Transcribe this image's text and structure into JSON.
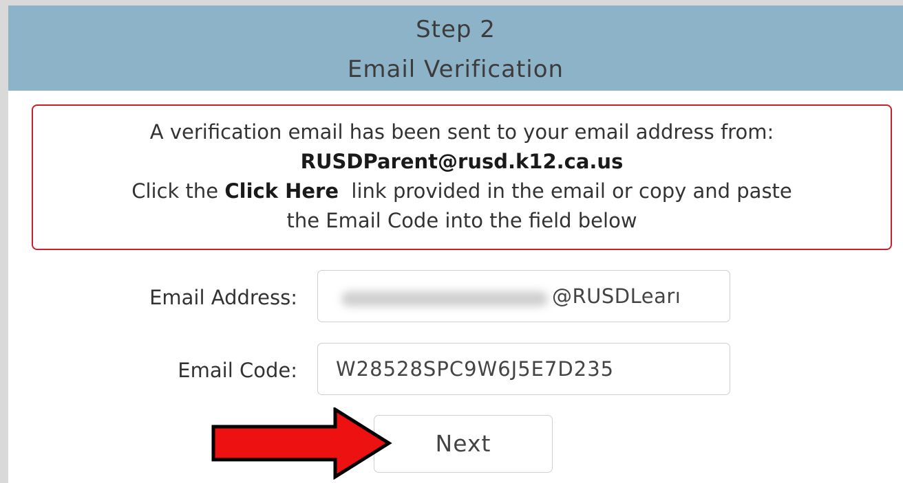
{
  "header": {
    "step": "Step 2",
    "title": "Email Verification"
  },
  "notice": {
    "line1": "A verification email has been sent to your email address from:",
    "sender": "RUSDParent@rusd.k12.ca.us",
    "line3_prefix": "Click the ",
    "line3_link": "Click Here",
    "line3_suffix": "  link provided in the email or copy and paste",
    "line4": "the Email Code into the field below"
  },
  "form": {
    "email_label": "Email Address:",
    "email_value_visible": "@RUSDLearı",
    "code_label": "Email Code:",
    "code_value": "W28528SPC9W6J5E7D235"
  },
  "actions": {
    "next_label": "Next"
  },
  "annotation": {
    "arrow_color": "#ee1111",
    "arrow_icon": "right-arrow-icon"
  },
  "colors": {
    "header_bg": "#8db3c9",
    "notice_border": "#c8202c"
  }
}
